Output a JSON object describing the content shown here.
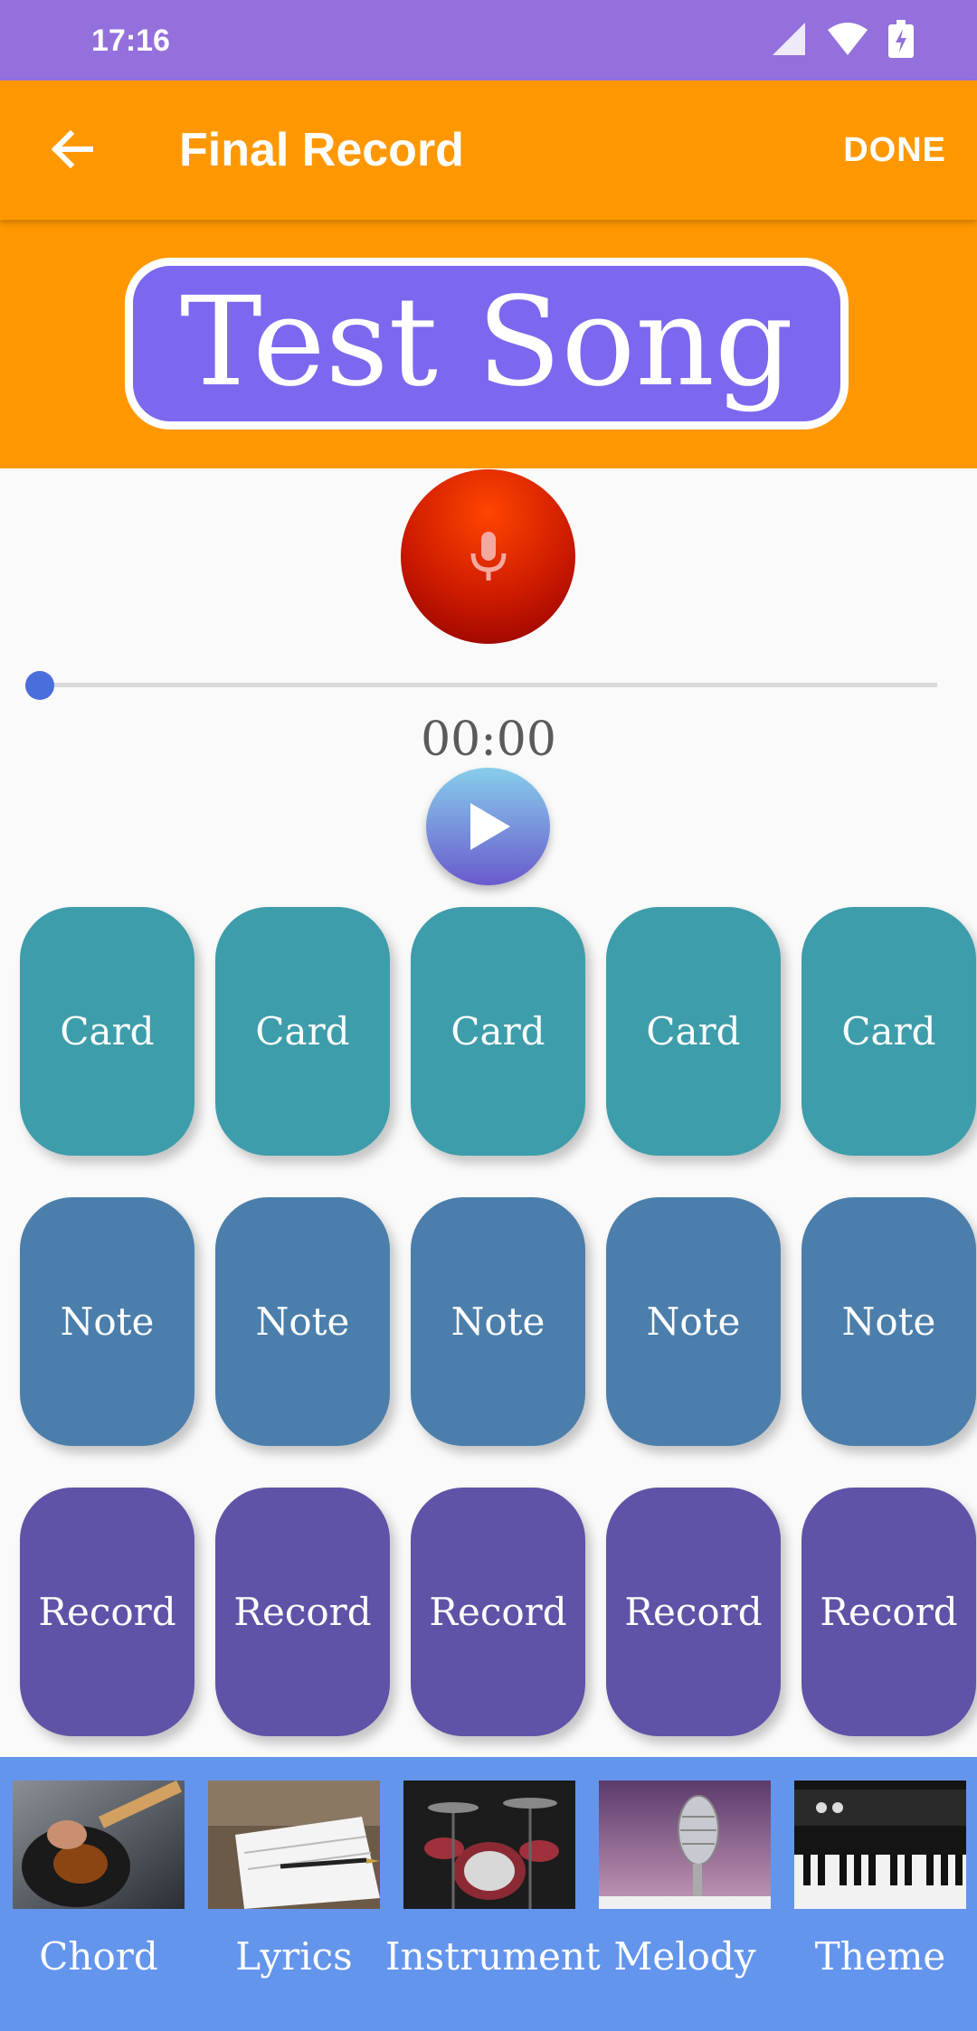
{
  "status_bar": {
    "time": "17:16"
  },
  "app_bar": {
    "title": "Final Record",
    "done_label": "DONE"
  },
  "song": {
    "title": "Test Song"
  },
  "player": {
    "time": "00:00",
    "progress": 0
  },
  "grid": {
    "rows": [
      {
        "type": "card",
        "labels": [
          "Card",
          "Card",
          "Card",
          "Card",
          "Card"
        ]
      },
      {
        "type": "note",
        "labels": [
          "Note",
          "Note",
          "Note",
          "Note",
          "Note"
        ]
      },
      {
        "type": "record",
        "labels": [
          "Record",
          "Record",
          "Record",
          "Record",
          "Record"
        ]
      }
    ]
  },
  "bottom_tabs": [
    {
      "label": "Chord",
      "image": "guitar-photo"
    },
    {
      "label": "Lyrics",
      "image": "notebook-pen-photo"
    },
    {
      "label": "Instrument",
      "image": "drum-kit-photo"
    },
    {
      "label": "Melody",
      "image": "microphone-photo"
    },
    {
      "label": "Theme",
      "image": "piano-photo"
    }
  ],
  "colors": {
    "status_bar": "#9370db",
    "app_bar": "#ff9800",
    "song_box": "#7b68ee",
    "card": "#3e9daa",
    "note": "#4b7eab",
    "record": "#5e53a6",
    "bottom_bar": "#6495ed"
  }
}
